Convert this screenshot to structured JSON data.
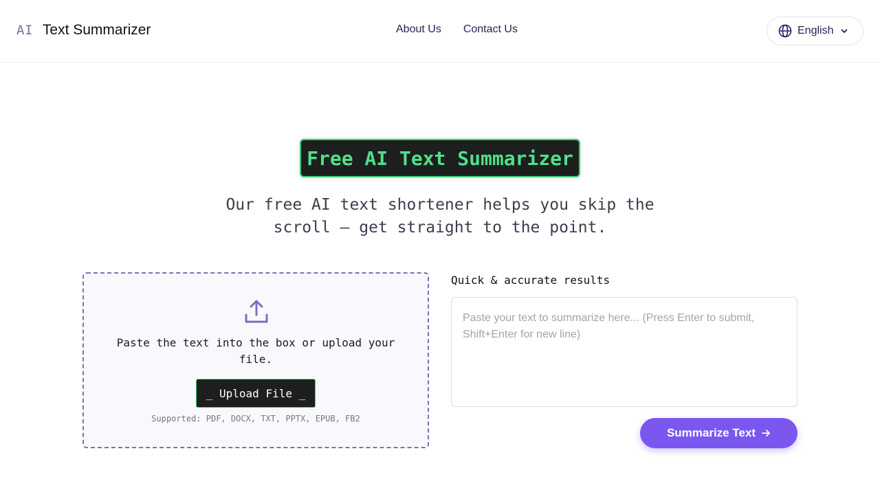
{
  "header": {
    "logo_mark": "AI",
    "logo_text": "Text Summarizer",
    "nav": [
      {
        "label": "About Us"
      },
      {
        "label": "Contact Us"
      }
    ],
    "language": {
      "label": "English",
      "icon": "globe-icon"
    }
  },
  "hero": {
    "title": "Free AI Text Summarizer",
    "subtitle": "Our free AI text shortener helps you skip the scroll — get straight to the point."
  },
  "upload": {
    "icon": "upload-icon",
    "instruction": "Paste the text into the box or upload your file.",
    "button_label": "_ Upload File _",
    "supported": "Supported: PDF, DOCX, TXT, PPTX, EPUB, FB2"
  },
  "input": {
    "label": "Quick & accurate results",
    "placeholder": "Paste your text to summarize here... (Press Enter to submit, Shift+Enter for new line)",
    "value": "",
    "submit_label": "Summarize Text"
  },
  "colors": {
    "accent": "#7b57f0",
    "badge_green": "#4ee08a",
    "badge_bg": "#1c1f1d",
    "nav_text": "#2a1d57"
  }
}
